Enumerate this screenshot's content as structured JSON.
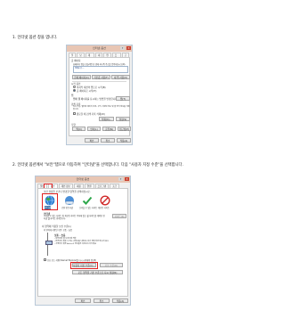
{
  "steps": [
    {
      "text": "1. 인터넷 옵션 창을 엽니다."
    },
    {
      "text": "2. 인터넷 옵션에서 \"보안\"탭으로 이동하여 \"인터넷\"을 선택합니다. 다음 \"사용자 지정 수준\"을 선택합니다."
    }
  ],
  "dialog1": {
    "title": "인터넷 옵션",
    "tabs": [
      "일반",
      "보안",
      "개인 정보",
      "내용",
      "연결",
      "프로그램",
      "고급"
    ],
    "home_group": "홈 페이지",
    "home_desc": "홈페이지 탭을 만들려면 한 행에 하나씩 주소를 입력하십시오(R).",
    "home_url": "http://...",
    "home_buttons": [
      "현재 페이지(C)",
      "기본값 사용(F)",
      "새 탭 사용(U)"
    ],
    "startup_group": "시작 옵션",
    "startup_opts": [
      "마지막 세션의 탭으로 시작(B)",
      "홈 페이지로 시작(H)"
    ],
    "tabs_group": "탭",
    "tabs_desc": "탭에 웹 페이지를 표시하는 방법을 변경합니다.",
    "tabs_btn": "탭(T)",
    "history_group": "검색 기록",
    "history_desc": "임시 파일, 열어본 페이지 목록, 쿠키, 저장된 암호 및 웹 양식 정보를 삭제합니다.",
    "history_chk": "종료할 때 검색 기록 삭제(W)",
    "history_buttons": [
      "삭제(D)...",
      "설정(S)"
    ],
    "appearance_group": "모양",
    "appearance_buttons": [
      "색(O)",
      "언어(L)",
      "글꼴(N)",
      "접근성(E)"
    ],
    "footer_buttons": [
      "확인",
      "취소",
      "적용(A)"
    ]
  },
  "dialog2": {
    "title": "인터넷 옵션",
    "tabs": [
      "일반",
      "보안",
      "개인 정보",
      "내용",
      "연결",
      "프로그램",
      "고급"
    ],
    "zone_prompt": "보안 설정을 보거나 변경할 영역을 선택하십시오.",
    "zones": [
      {
        "label": "인터넷",
        "icon": "globe-icon"
      },
      {
        "label": "로컬 인트라넷",
        "icon": "intranet-icon"
      },
      {
        "label": "신뢰할 수 있는 사이트",
        "icon": "check-icon"
      },
      {
        "label": "제한된 사이트",
        "icon": "restricted-icon"
      }
    ],
    "zone_title": "인터넷",
    "zone_desc": "신뢰할 수 있는 사이트 및 제한된 사이트 목록에 있는 웹 사이트를 제외한 인터넷 웹 사이트 영역입니다.",
    "sites_btn": "사이트(S)",
    "level_group": "이 영역에 적용할 보안 수준(L)",
    "level_sub": "이 영역에 허용된 수준: 보통 - 높음",
    "level_name": "보통 - 높음",
    "level_bullets": [
      "- 대부분의 웹 사이트에 적합",
      "- 안전하지 않을 수 있는 콘텐츠를 다운로드하기 전에 확인 메시지 표시",
      "- 서명되지 않은 ActiveX 컨트롤은 다운로드하지 않음"
    ],
    "protected_mode": "보호 모드 사용(Internet Explorer를 다시 시작해야 함)(P)",
    "custom_btn": "사용자 지정 수준(C)...",
    "default_btn": "기본 수준(D)",
    "reset_all_btn": "모든 영역을 기본 수준으로 다시 설정(R)",
    "footer_buttons": [
      "확인",
      "취소",
      "적용(A)"
    ]
  }
}
